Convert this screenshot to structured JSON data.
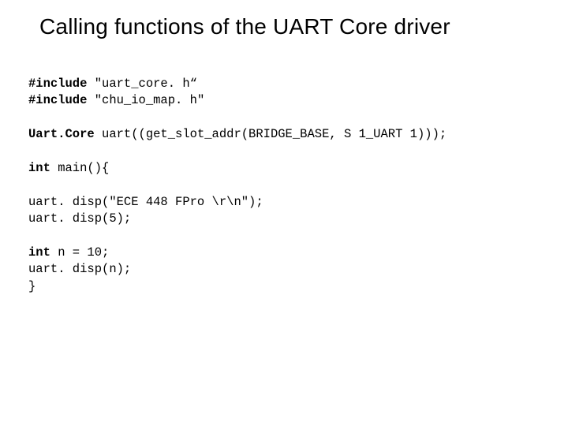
{
  "title": "Calling functions of the UART Core driver",
  "code": {
    "l01a": "#include",
    "l01b": " \"uart_core. h“",
    "l02a": "#include",
    "l02b": " \"chu_io_map. h\"",
    "blank1": "",
    "l03a": "Uart.Core",
    "l03b": " uart((get_slot_addr(BRIDGE_BASE, S 1_UART 1)));",
    "blank2": "",
    "l04a": "int",
    "l04b": " main(){",
    "blank3": "",
    "l05": "uart. disp(\"ECE 448 FPro \\r\\n\");",
    "l06": "uart. disp(5);",
    "blank4": "",
    "l07a": "int",
    "l07b": " n = 10;",
    "l08": "uart. disp(n);",
    "l09": "}"
  }
}
